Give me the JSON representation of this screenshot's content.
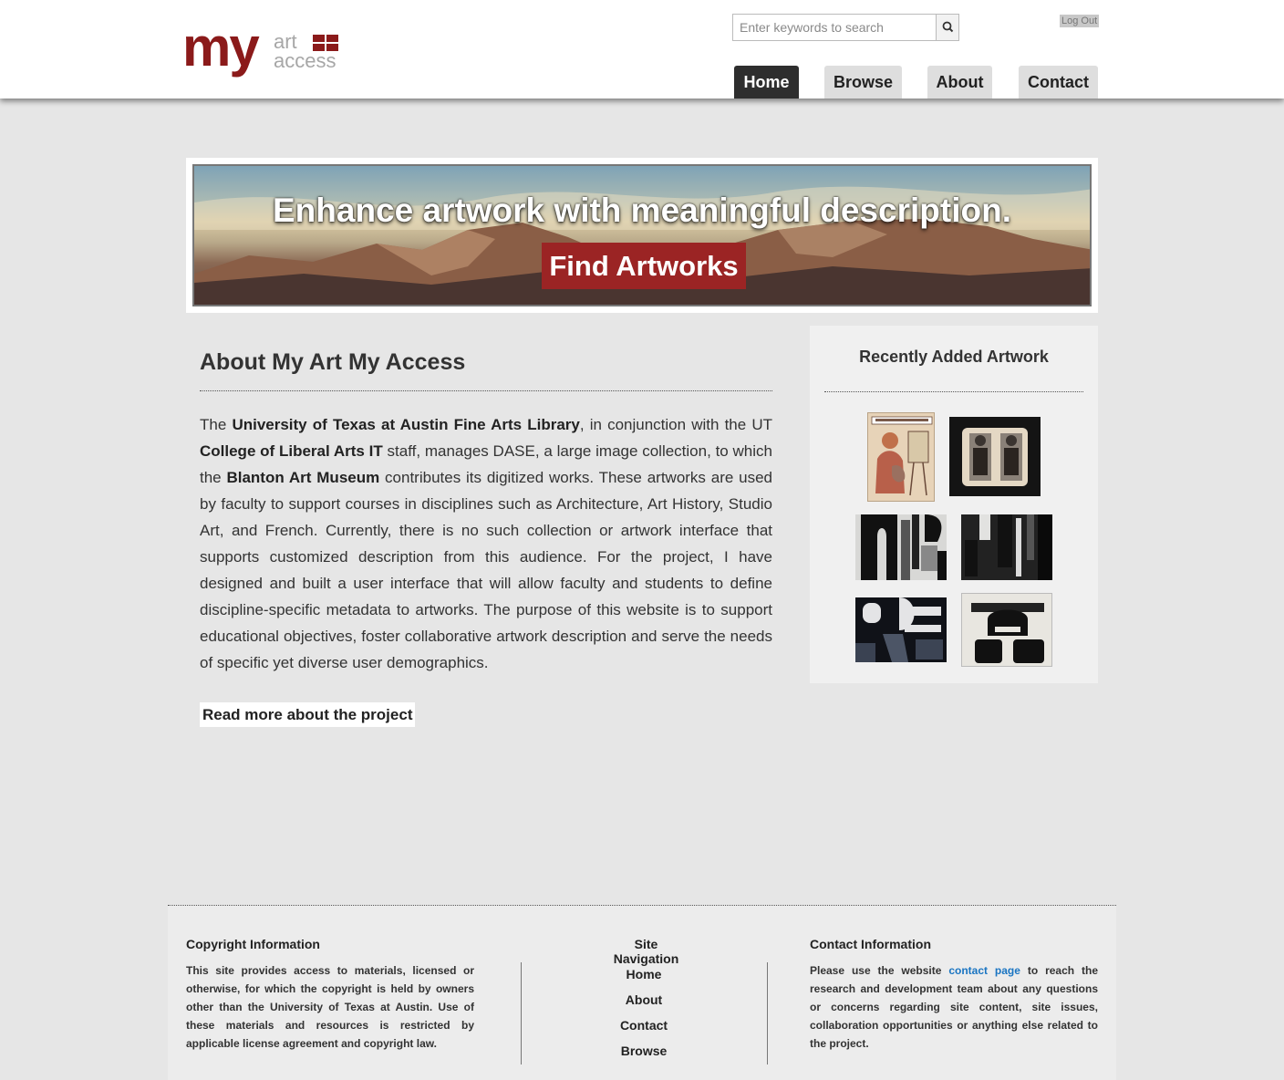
{
  "header": {
    "logo": {
      "my": "my",
      "art": "art",
      "access": "access"
    },
    "search": {
      "placeholder": "Enter keywords to search"
    },
    "logout_label": "Log Out",
    "nav": [
      {
        "label": "Home"
      },
      {
        "label": "Browse"
      },
      {
        "label": "About"
      },
      {
        "label": "Contact"
      }
    ]
  },
  "banner": {
    "title": "Enhance artwork with meaningful description.",
    "button_label": "Find Artworks"
  },
  "about": {
    "title": "About My Art My Access",
    "paragraph": [
      {
        "text": "The ",
        "bold": false
      },
      {
        "text": "University of Texas at Austin Fine Arts Library",
        "bold": true
      },
      {
        "text": ", in conjunction with the UT ",
        "bold": false
      },
      {
        "text": "College of Liberal Arts IT",
        "bold": true
      },
      {
        "text": " staff, manages DASE, a large image collection, to which the ",
        "bold": false
      },
      {
        "text": "Blanton Art Museum",
        "bold": true
      },
      {
        "text": " contributes its digitized works. These artworks are used by faculty to support courses in disciplines such as Architecture, Art History, Studio Art, and French. Currently, there is no such collection or artwork interface that supports customized description from this audience. For the project, I have designed and built a user interface that will allow faculty and students to define discipline-specific metadata to artworks. The purpose of this website is to support educational objectives, foster collaborative artwork description and serve the needs of specific yet diverse user demographics.",
        "bold": false
      }
    ],
    "read_more_label": "Read more about the project"
  },
  "recent": {
    "title": "Recently Added Artwork"
  },
  "footer": {
    "copyright": {
      "heading": "Copyright Information",
      "text": "This site provides access to materials, licensed or otherwise, for which the copyright is held by owners other than the University of Texas at Austin. Use of these materials and resources is restricted by applicable license agreement and copyright law."
    },
    "site_nav": {
      "heading": "Site Navigation",
      "links": [
        "Home",
        "About",
        "Contact",
        "Browse"
      ]
    },
    "contact": {
      "heading": "Contact Information",
      "text_before": "Please use the website ",
      "link_label": "contact page",
      "text_after": " to reach the research and development team about any questions or concerns regarding site content, site issues, collaboration opportunities or anything else related to the project."
    }
  }
}
